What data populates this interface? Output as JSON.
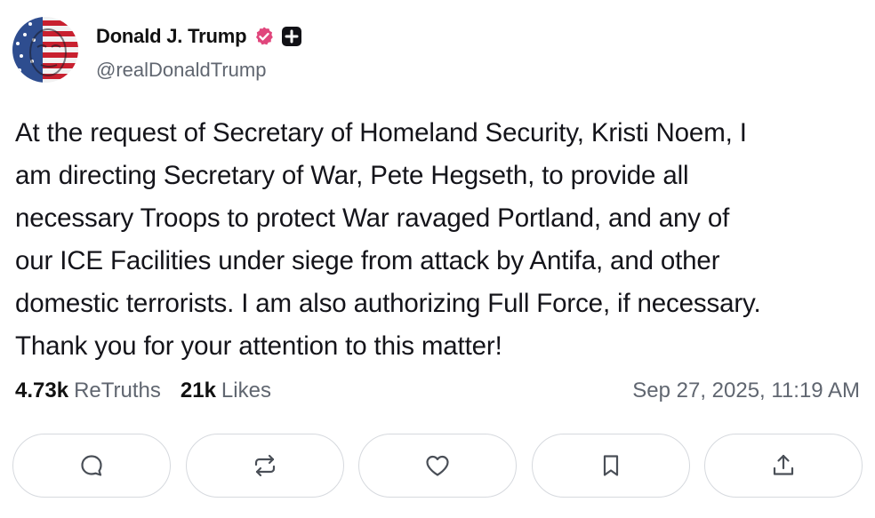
{
  "post": {
    "author": {
      "display_name": "Donald J. Trump",
      "handle": "@realDonaldTrump",
      "verified_badge_color": "#e0467c",
      "avatar_icon": "flag-face-avatar"
    },
    "body_lines": [
      "At the request of Secretary of Homeland Security, Kristi Noem, I",
      "am directing Secretary of War, Pete Hegseth, to provide all",
      "necessary Troops to protect War ravaged Portland, and any of",
      "our ICE Facilities under siege from attack by Antifa, and other",
      "domestic terrorists. I am also authorizing Full Force, if necessary.",
      "Thank you for your attention to this matter!"
    ],
    "stats": {
      "retruths_count": "4.73k",
      "retruths_label": "ReTruths",
      "likes_count": "21k",
      "likes_label": "Likes"
    },
    "timestamp": "Sep 27, 2025, 11:19 AM"
  },
  "actions": [
    {
      "name": "reply-button",
      "icon": "comment-icon"
    },
    {
      "name": "retruth-button",
      "icon": "repost-icon"
    },
    {
      "name": "like-button",
      "icon": "heart-icon"
    },
    {
      "name": "bookmark-button",
      "icon": "bookmark-icon"
    },
    {
      "name": "share-button",
      "icon": "share-icon"
    }
  ]
}
